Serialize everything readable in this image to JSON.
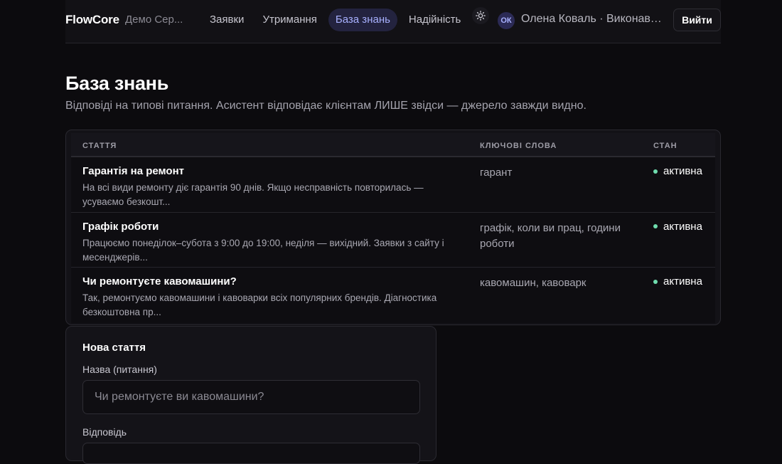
{
  "header": {
    "brand": "FlowCore",
    "org": "Демо Сер...",
    "nav": [
      {
        "label": "Заявки",
        "active": false
      },
      {
        "label": "Утримання",
        "active": false
      },
      {
        "label": "База знань",
        "active": true
      },
      {
        "label": "Надійність",
        "active": false
      }
    ],
    "theme_icon": "sun-icon",
    "avatar_initials": "ОК",
    "user": "Олена Коваль · Виконаве...",
    "logout_label": "Вийти"
  },
  "page": {
    "title": "База знань",
    "subtitle": "Відповіді на типові питання. Асистент відповідає клієнтам ЛИШЕ звідси — джерело завжди видно."
  },
  "table": {
    "columns": [
      "Стаття",
      "Ключові слова",
      "Стан"
    ],
    "rows": [
      {
        "title": "Гарантія на ремонт",
        "body": "На всі види ремонту діє гарантія 90 днів. Якщо несправність повторилась — усуваємо безкошт...",
        "keywords": "гарант",
        "status": "активна"
      },
      {
        "title": "Графік роботи",
        "body": "Працюємо понеділок–субота з 9:00 до 19:00, неділя — вихідний. Заявки з сайту і месенджерів...",
        "keywords": "графік, коли ви прац, години роботи",
        "status": "активна"
      },
      {
        "title": "Чи ремонтуєте кавомашини?",
        "body": "Так, ремонтуємо кавомашини і кавоварки всіх популярних брендів. Діагностика безкоштовна пр...",
        "keywords": "кавомашин, кавоварк",
        "status": "активна"
      }
    ],
    "status_color": "#6fdcae"
  },
  "form": {
    "title": "Нова стаття",
    "name_label": "Назва (питання)",
    "name_placeholder": "Чи ремонтуєте ви кавомашини?",
    "answer_label": "Відповідь"
  },
  "colors": {
    "accent": "#a8b1ff",
    "active_nav_bg": "#23233f",
    "background": "#0c0b0e"
  }
}
